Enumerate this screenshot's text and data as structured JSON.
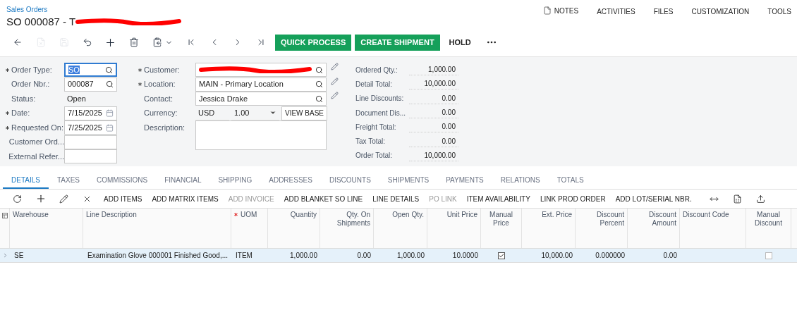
{
  "breadcrumb": "Sales Orders",
  "title": "SO 000087 - T",
  "title_redacted": true,
  "top_menu": [
    {
      "label": "NOTES",
      "kind": "notes"
    },
    {
      "label": "ACTIVITIES",
      "kind": "text"
    },
    {
      "label": "FILES",
      "kind": "text"
    },
    {
      "label": "CUSTOMIZATION",
      "kind": "text"
    },
    {
      "label": "TOOLS",
      "kind": "text"
    }
  ],
  "toolbar": [
    {
      "kind": "back",
      "disabled": false
    },
    {
      "kind": "cancel",
      "disabled": true
    },
    {
      "kind": "save",
      "disabled": true
    },
    {
      "kind": "undo",
      "disabled": false
    },
    {
      "kind": "add",
      "disabled": false
    },
    {
      "kind": "delete",
      "disabled": false
    },
    {
      "kind": "copy",
      "disabled": false
    },
    {
      "kind": "first",
      "disabled": false
    },
    {
      "kind": "prev",
      "disabled": false
    },
    {
      "kind": "next",
      "disabled": false
    },
    {
      "kind": "last",
      "disabled": false
    }
  ],
  "actions": [
    {
      "label": "QUICK PROCESS",
      "primary": true
    },
    {
      "label": "CREATE SHIPMENT",
      "primary": true
    },
    {
      "label": "HOLD",
      "primary": false
    }
  ],
  "form_left": [
    {
      "label": "Order Type:",
      "required": true,
      "kind": "lookup",
      "value": "SO",
      "highlighted": true
    },
    {
      "label": "Order Nbr.:",
      "required": false,
      "kind": "lookup",
      "value": "000087",
      "highlighted": false
    },
    {
      "label": "Status:",
      "required": false,
      "kind": "text",
      "value": "Open",
      "highlighted": false
    },
    {
      "label": "Date:",
      "required": true,
      "kind": "date",
      "value": "7/15/2025",
      "highlighted": false
    },
    {
      "label": "Requested On:",
      "required": true,
      "kind": "date",
      "value": "7/25/2025",
      "highlighted": false
    },
    {
      "label": "Customer Ord...",
      "required": false,
      "kind": "input",
      "highlighted": false
    },
    {
      "label": "External Refer...",
      "required": false,
      "kind": "input",
      "highlighted": false
    }
  ],
  "form_middle": [
    {
      "label": "Customer:",
      "required": true,
      "kind": "redacted"
    },
    {
      "label": "Location:",
      "required": true,
      "kind": "lookup",
      "value": "MAIN - Primary Location"
    },
    {
      "label": "Contact:",
      "required": false,
      "kind": "lookup",
      "value": "Jessica Drake"
    },
    {
      "label": "Currency:",
      "required": false,
      "kind": "currency",
      "value": "USD"
    },
    {
      "label": "Description:",
      "required": false,
      "kind": "textarea"
    }
  ],
  "currency": {
    "rate": "1.00",
    "button": "VIEW BASE"
  },
  "totals": [
    {
      "label": "Ordered Qty.:",
      "value": "1,000.00"
    },
    {
      "label": "Detail Total:",
      "value": "10,000.00"
    },
    {
      "label": "Line Discounts:",
      "value": "0.00"
    },
    {
      "label": "Document Dis...",
      "value": "0.00"
    },
    {
      "label": "Freight Total:",
      "value": "0.00"
    },
    {
      "label": "Tax Total:",
      "value": "0.00"
    },
    {
      "label": "Order Total:",
      "value": "10,000.00"
    }
  ],
  "tabs": [
    {
      "label": "DETAILS",
      "selected": true
    },
    {
      "label": "TAXES",
      "selected": false
    },
    {
      "label": "COMMISSIONS",
      "selected": false
    },
    {
      "label": "FINANCIAL",
      "selected": false
    },
    {
      "label": "SHIPPING",
      "selected": false
    },
    {
      "label": "ADDRESSES",
      "selected": false
    },
    {
      "label": "DISCOUNTS",
      "selected": false
    },
    {
      "label": "SHIPMENTS",
      "selected": false
    },
    {
      "label": "PAYMENTS",
      "selected": false
    },
    {
      "label": "RELATIONS",
      "selected": false
    },
    {
      "label": "TOTALS",
      "selected": false
    }
  ],
  "grid_toolbar": {
    "icons_left": [
      {
        "kind": "refresh"
      },
      {
        "kind": "add"
      },
      {
        "kind": "edit"
      },
      {
        "kind": "delete"
      }
    ],
    "buttons": [
      {
        "label": "ADD ITEMS",
        "disabled": false
      },
      {
        "label": "ADD MATRIX ITEMS",
        "disabled": false
      },
      {
        "label": "ADD INVOICE",
        "disabled": true
      },
      {
        "label": "ADD BLANKET SO LINE",
        "disabled": false
      },
      {
        "label": "LINE DETAILS",
        "disabled": false
      },
      {
        "label": "PO LINK",
        "disabled": true
      },
      {
        "label": "ITEM AVAILABILITY",
        "disabled": false
      },
      {
        "label": "LINK PROD ORDER",
        "disabled": false
      },
      {
        "label": "ADD LOT/SERIAL NBR.",
        "disabled": false
      }
    ],
    "icons_right": [
      {
        "kind": "fit"
      },
      {
        "kind": "excel"
      },
      {
        "kind": "upload"
      }
    ]
  },
  "table": {
    "columns": [
      {
        "label": "Warehouse",
        "kind": "text",
        "required": false
      },
      {
        "label": "Line Description",
        "kind": "text",
        "required": false
      },
      {
        "label": "UOM",
        "kind": "text",
        "required": true
      },
      {
        "label": "Quantity",
        "kind": "number",
        "required": false
      },
      {
        "label": "Qty. On Shipments",
        "kind": "number",
        "required": false
      },
      {
        "label": "Open Qty.",
        "kind": "number",
        "required": false
      },
      {
        "label": "Unit Price",
        "kind": "number",
        "required": false
      },
      {
        "label": "Manual Price",
        "kind": "check",
        "required": false
      },
      {
        "label": "Ext. Price",
        "kind": "number",
        "required": false
      },
      {
        "label": "Discount Percent",
        "kind": "number",
        "required": false
      },
      {
        "label": "Discount Amount",
        "kind": "number",
        "required": false
      },
      {
        "label": "Discount Code",
        "kind": "text",
        "required": false
      },
      {
        "label": "Manual Discount",
        "kind": "check",
        "required": false
      }
    ],
    "rows": [
      {
        "selected": true,
        "cells": [
          {
            "kind": "text",
            "value": "SE"
          },
          {
            "kind": "text",
            "value": "Examination Glove 000001 Finished Good,..."
          },
          {
            "kind": "text",
            "value": "ITEM"
          },
          {
            "kind": "text",
            "value": "1,000.00"
          },
          {
            "kind": "text",
            "value": "0.00"
          },
          {
            "kind": "text",
            "value": "1,000.00"
          },
          {
            "kind": "text",
            "value": "10.0000"
          },
          {
            "kind": "check",
            "checked": true
          },
          {
            "kind": "text",
            "value": "10,000.00"
          },
          {
            "kind": "text",
            "value": "0.000000"
          },
          {
            "kind": "text",
            "value": "0.00"
          },
          {
            "kind": "empty"
          },
          {
            "kind": "check",
            "checked": false
          }
        ]
      }
    ]
  }
}
